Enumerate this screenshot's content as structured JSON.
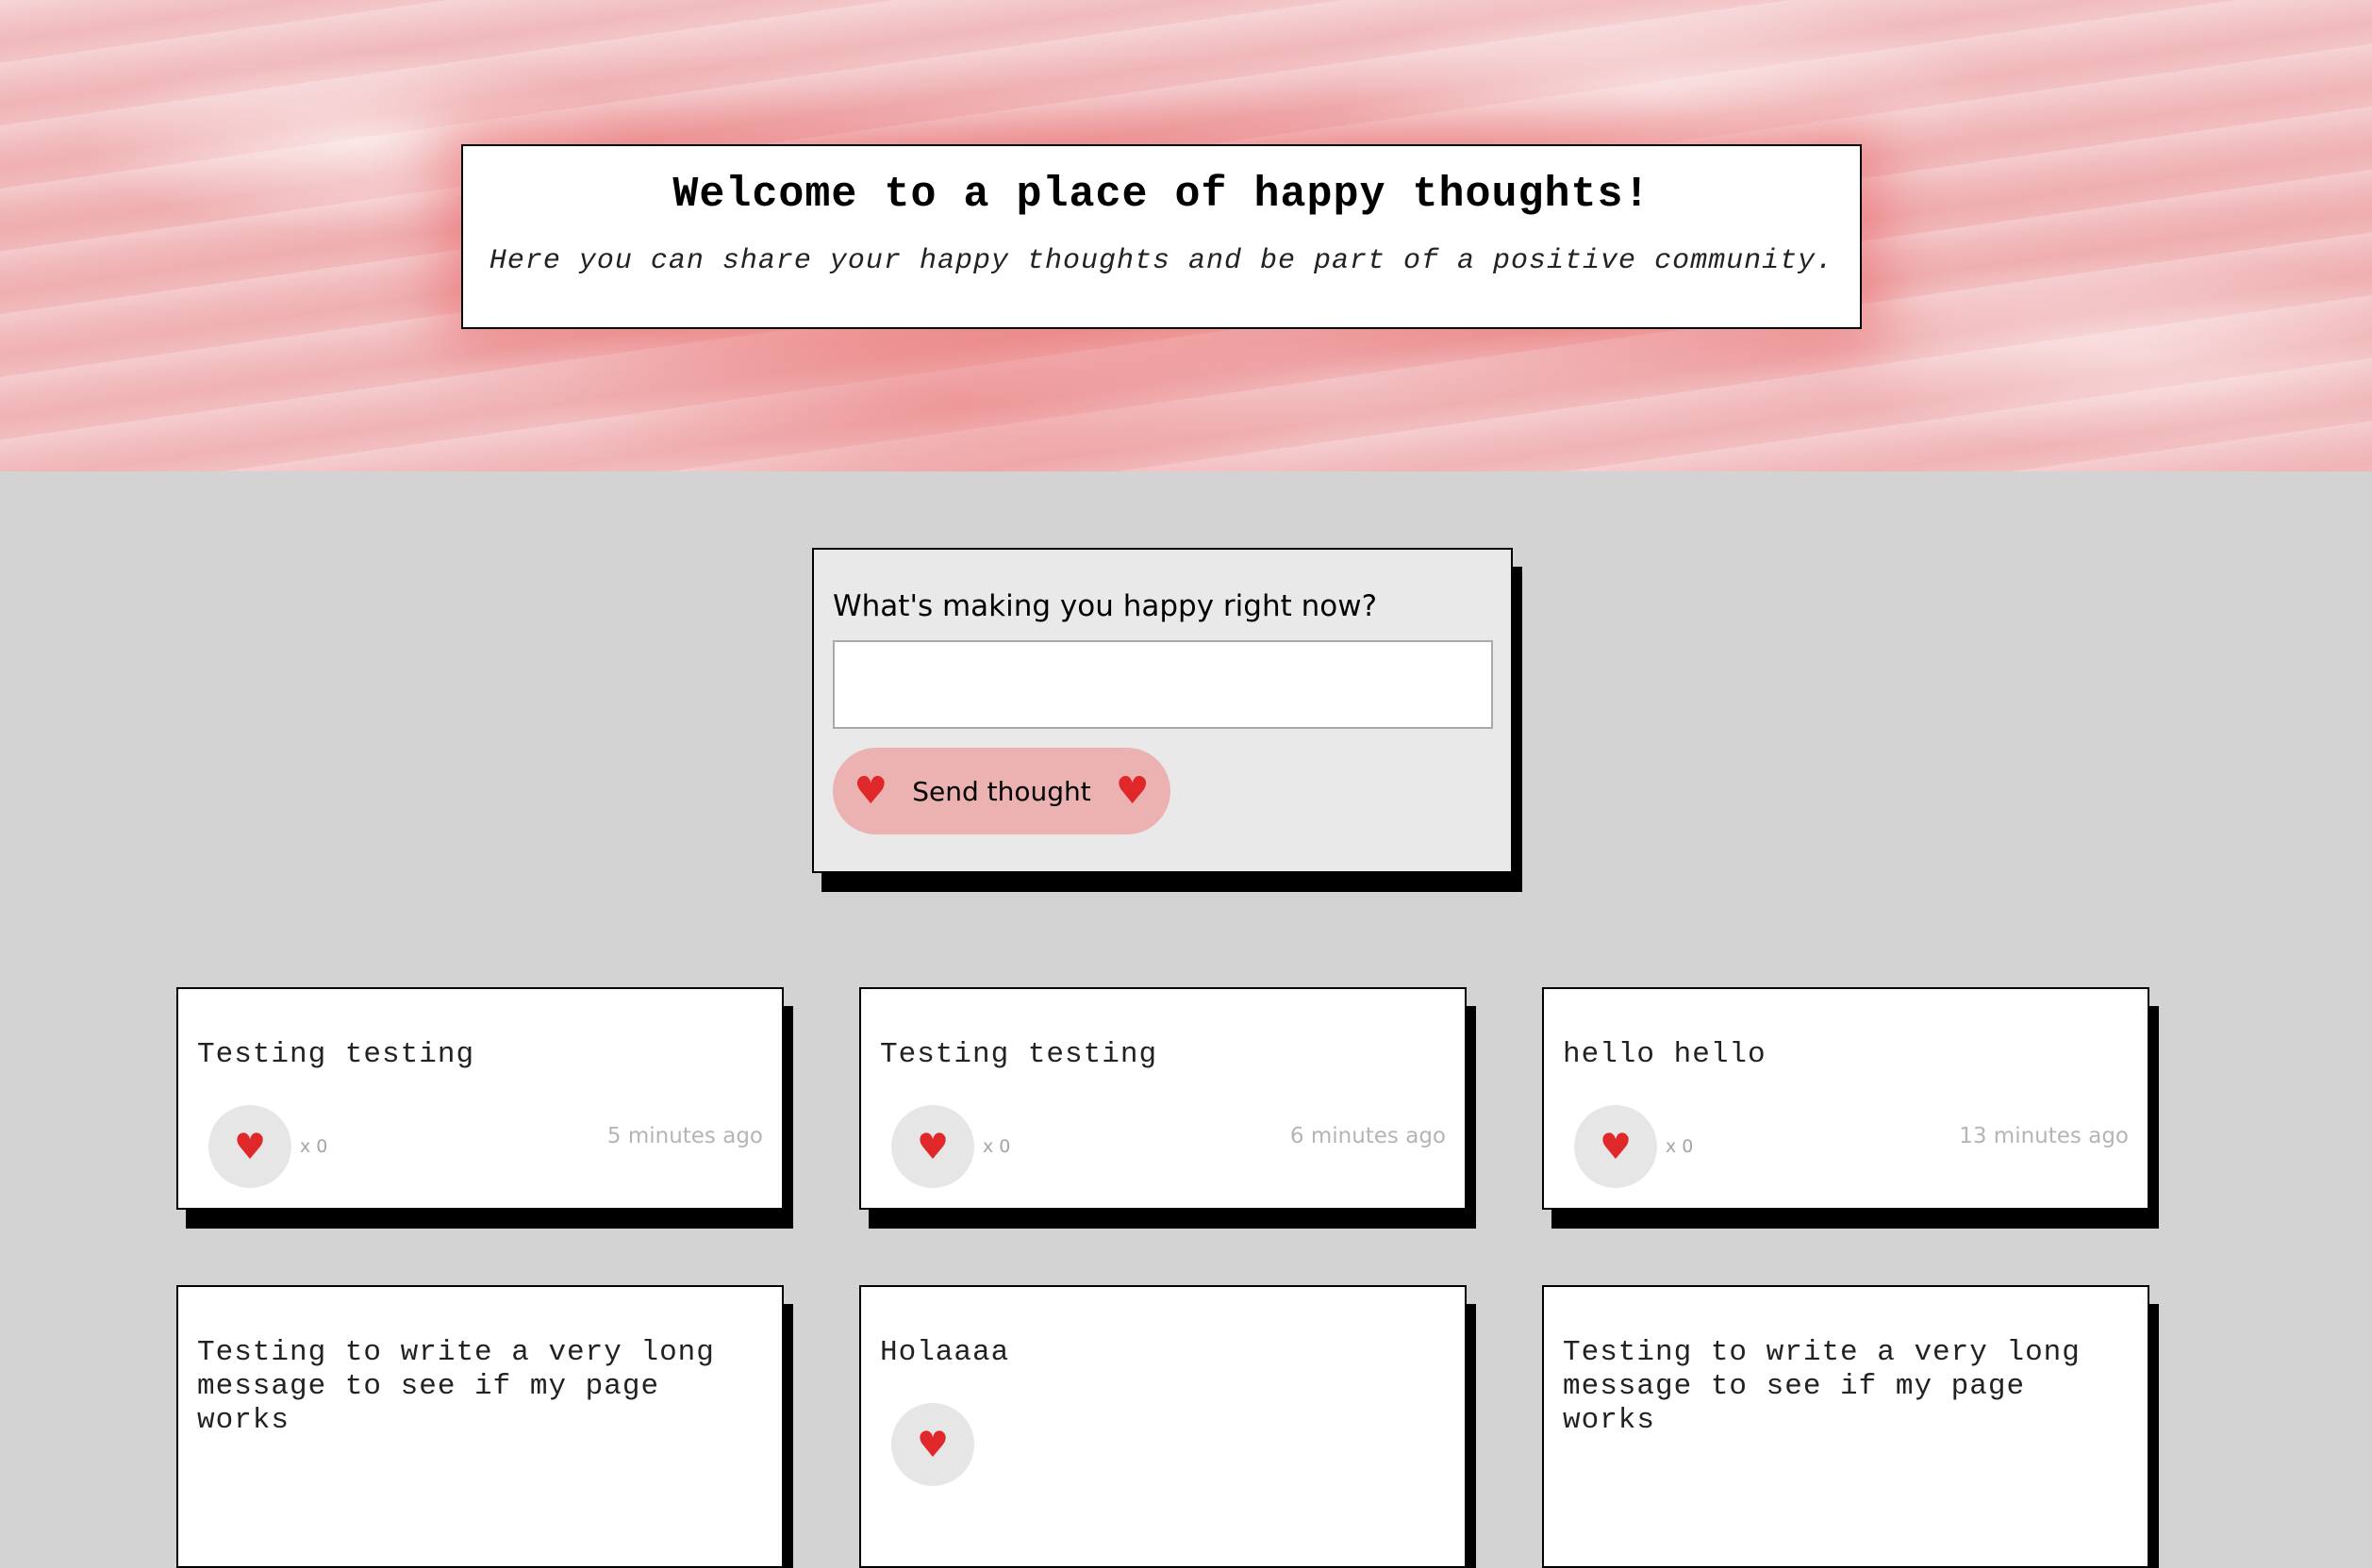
{
  "header": {
    "title": "Welcome to a place of happy thoughts!",
    "subtitle": "Here you can share your happy thoughts and be part of a positive community."
  },
  "form": {
    "label": "What's making you happy right now?",
    "input_value": "",
    "input_placeholder": "",
    "send_label": "Send thought",
    "heart_glyph": "♥"
  },
  "thoughts": [
    {
      "message": "Testing testing",
      "likes": "x 0",
      "time": "5 minutes ago"
    },
    {
      "message": "Testing testing",
      "likes": "x 0",
      "time": "6 minutes ago"
    },
    {
      "message": "hello hello",
      "likes": "x 0",
      "time": "13 minutes ago"
    },
    {
      "message": "Testing to write a very long message to see if my page works",
      "likes": "",
      "time": ""
    },
    {
      "message": "Holaaaa",
      "likes": "",
      "time": ""
    },
    {
      "message": "Testing to write a very long message to see if my page works",
      "likes": "",
      "time": ""
    }
  ],
  "colors": {
    "heart": "#e0282a",
    "button_bg": "#ecb1b1",
    "page_bg": "#d3d3d3",
    "hero_pink": "#f1b7b9"
  }
}
